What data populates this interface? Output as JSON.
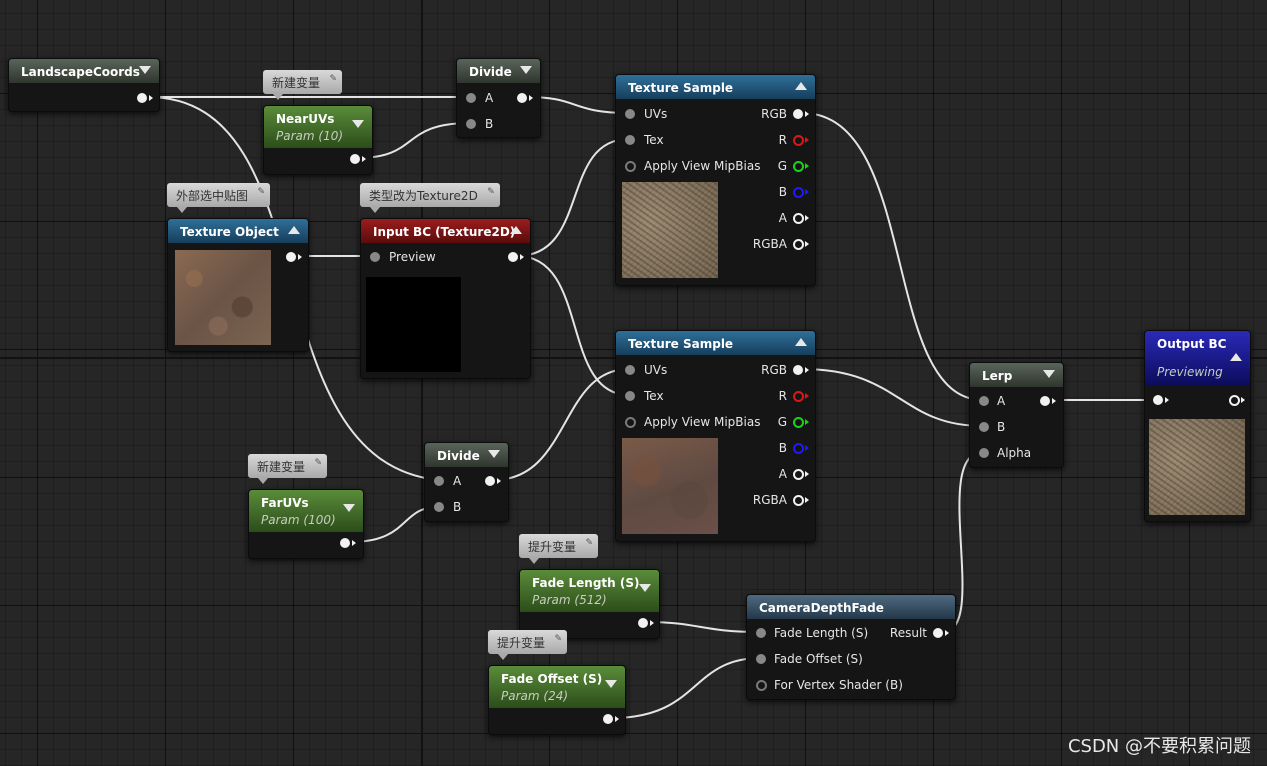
{
  "nodes": {
    "landscape_coords": {
      "title": "LandscapeCoords"
    },
    "divide_top": {
      "title": "Divide",
      "pin_a": "A",
      "pin_b": "B"
    },
    "near_uvs": {
      "title": "NearUVs",
      "subtitle": "Param (10)"
    },
    "texture_sample_top": {
      "title": "Texture Sample",
      "inputs": [
        "UVs",
        "Tex",
        "Apply View MipBias"
      ],
      "outputs": [
        "RGB",
        "R",
        "G",
        "B",
        "A",
        "RGBA"
      ]
    },
    "texture_object": {
      "title": "Texture Object"
    },
    "input_bc": {
      "title": "Input BC (Texture2D)",
      "pin": "Preview"
    },
    "texture_sample_bottom": {
      "title": "Texture Sample",
      "inputs": [
        "UVs",
        "Tex",
        "Apply View MipBias"
      ],
      "outputs": [
        "RGB",
        "R",
        "G",
        "B",
        "A",
        "RGBA"
      ]
    },
    "divide_bottom": {
      "title": "Divide",
      "pin_a": "A",
      "pin_b": "B"
    },
    "far_uvs": {
      "title": "FarUVs",
      "subtitle": "Param (100)"
    },
    "lerp": {
      "title": "Lerp",
      "pins": [
        "A",
        "B",
        "Alpha"
      ]
    },
    "output_bc": {
      "title": "Output BC",
      "subtitle": "Previewing"
    },
    "fade_length": {
      "title": "Fade Length (S)",
      "subtitle": "Param (512)"
    },
    "fade_offset": {
      "title": "Fade Offset (S)",
      "subtitle": "Param (24)"
    },
    "camera_depth_fade": {
      "title": "CameraDepthFade",
      "inputs": [
        "Fade Length (S)",
        "Fade Offset (S)",
        "For Vertex Shader (B)"
      ],
      "output": "Result"
    }
  },
  "comments": {
    "near_uvs": "新建变量",
    "texture_object": "外部选中贴图",
    "input_bc": "类型改为Texture2D",
    "far_uvs": "新建变量",
    "fade_length": "提升变量",
    "fade_offset": "提升变量"
  },
  "watermark": "CSDN @不要积累问题",
  "colors": {
    "wire": "#e8e8e8",
    "pin_r": "#e01515",
    "pin_g": "#18d418",
    "pin_b": "#1b1bff"
  }
}
